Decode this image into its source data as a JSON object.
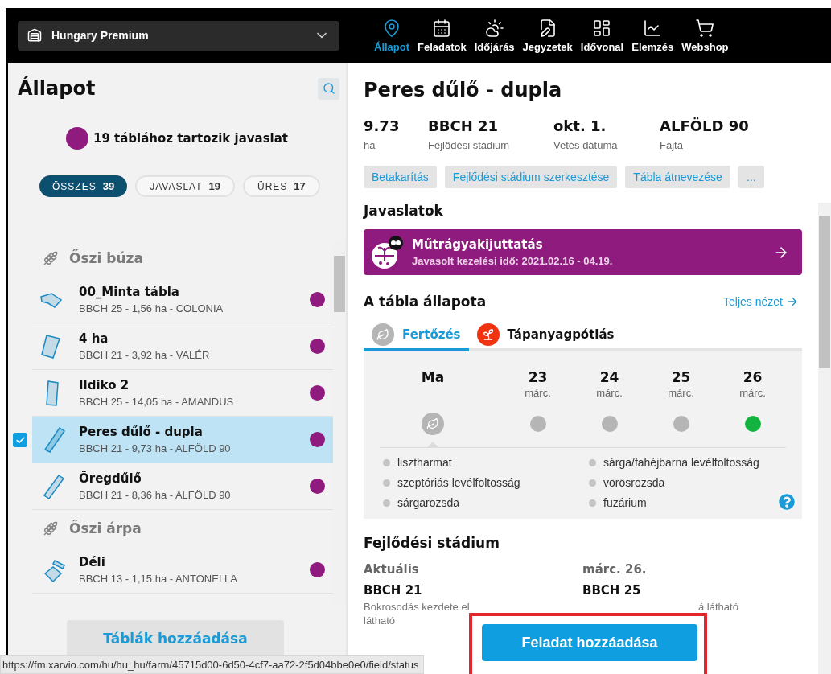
{
  "farm_selector": {
    "name": "Hungary Premium"
  },
  "nav": [
    {
      "label": "Állapot",
      "selected": true
    },
    {
      "label": "Feladatok",
      "selected": false
    },
    {
      "label": "Időjárás",
      "selected": false
    },
    {
      "label": "Jegyzetek",
      "selected": false
    },
    {
      "label": "Idővonal",
      "selected": false
    },
    {
      "label": "Elemzés",
      "selected": false
    },
    {
      "label": "Webshop",
      "selected": false
    }
  ],
  "sidebar": {
    "title": "Állapot",
    "legend": {
      "text": "19 táblához tartozik javaslat",
      "color": "#8e1b7d"
    },
    "filters": [
      {
        "label": "ÖSSZES",
        "count": "39",
        "selected": true
      },
      {
        "label": "JAVASLAT",
        "count": "19",
        "selected": false
      },
      {
        "label": "ÜRES",
        "count": "17",
        "selected": false
      }
    ],
    "groups": [
      {
        "name": "Őszi búza",
        "fields": [
          {
            "name": "00_Minta tábla",
            "details": "BBCH 25 - 1,56 ha - COLONIA",
            "selected": false,
            "color": "#8e1b7d"
          },
          {
            "name": "4 ha",
            "details": "BBCH 21 - 3,92 ha - VALÉR",
            "selected": false,
            "color": "#8e1b7d"
          },
          {
            "name": "Ildiko 2",
            "details": "BBCH 25 - 14,05 ha - AMANDUS",
            "selected": false,
            "color": "#8e1b7d"
          },
          {
            "name": "Peres dűlő - dupla",
            "details": "BBCH 21 - 9,73 ha - ALFÖLD 90",
            "selected": true,
            "color": "#8e1b7d"
          },
          {
            "name": "Öregdűlő",
            "details": "BBCH 21 - 8,36 ha - ALFÖLD 90",
            "selected": false,
            "color": "#8e1b7d"
          }
        ]
      },
      {
        "name": "Őszi árpa",
        "fields": [
          {
            "name": "Déli",
            "details": "BBCH 13 - 1,15 ha - ANTONELLA",
            "selected": false,
            "color": "#8e1b7d"
          }
        ]
      }
    ],
    "add_button": "Táblák hozzáadása"
  },
  "field": {
    "title": "Peres dűlő - dupla",
    "stats": [
      {
        "value": "9.73",
        "label": "ha"
      },
      {
        "value": "BBCH 21",
        "label": "Fejlődési stádium"
      },
      {
        "value": "okt. 1.",
        "label": "Vetés dátuma"
      },
      {
        "value": "ALFÖLD 90",
        "label": "Fajta"
      }
    ],
    "actions": [
      "Betakarítás",
      "Fejlődési stádium szerkesztése",
      "Tábla átnevezése",
      "..."
    ],
    "recommendations_title": "Javaslatok",
    "recommendation": {
      "title": "Műtrágyakijuttatás",
      "subtitle": "Javasolt kezelési idő: 2021.02.16 - 04.19."
    },
    "status_title": "A tábla állapota",
    "full_view_link": "Teljes nézet",
    "tabs": [
      {
        "label": "Fertőzés",
        "selected": true
      },
      {
        "label": "Tápanyagpótlás",
        "selected": false
      }
    ],
    "days": [
      {
        "day": "Ma",
        "kind": "today",
        "color": "#b5b5b5"
      },
      {
        "day": "23",
        "month": "márc.",
        "kind": "dot",
        "color": "#b5b5b5"
      },
      {
        "day": "24",
        "month": "márc.",
        "kind": "dot",
        "color": "#b5b5b5"
      },
      {
        "day": "25",
        "month": "márc.",
        "kind": "dot",
        "color": "#b5b5b5"
      },
      {
        "day": "26",
        "month": "márc.",
        "kind": "dot",
        "color": "#12b33f"
      }
    ],
    "diseases": [
      "lisztharmat",
      "sárga/fahéjbarna levélfoltosság",
      "szeptóriás levélfoltosság",
      "vörösrozsda",
      "sárgarozsda",
      "fuzárium"
    ],
    "growth": {
      "title": "Fejlődési stádium",
      "columns": [
        {
          "heading": "Aktuális",
          "stage": "BBCH 21",
          "lines": [
            "Bokrosodás kezdete el",
            "látható"
          ]
        },
        {
          "heading": "márc. 26.",
          "stage": "BBCH 25",
          "lines": [
            "á látható"
          ]
        }
      ]
    }
  },
  "add_task_button": "Feladat hozzáadása",
  "status_url": "https://fm.xarvio.com/hu/hu_hu/farm/45715d00-6d50-4cf7-aa72-2f5d04bbe0e0/field/status"
}
